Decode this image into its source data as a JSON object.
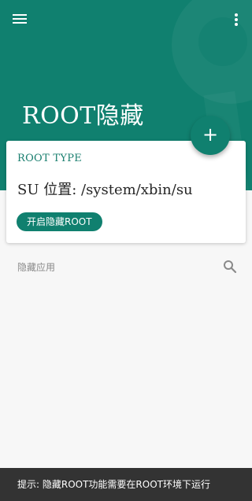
{
  "app": {
    "title": "ROOT隐藏",
    "menu_icon": "hamburger-menu-icon",
    "more_icon": "more-vertical-icon",
    "accent_color": "#10806f"
  },
  "card": {
    "label": "ROOT TYPE",
    "su_path": "SU 位置: /system/xbin/su",
    "action_button": "开启隐藏ROOT"
  },
  "fab": {
    "icon": "plus-icon",
    "symbol": "+"
  },
  "hidden_apps": {
    "header": "隐藏应用",
    "search_icon": "search-icon"
  },
  "toast": {
    "message": "提示: 隐藏ROOT功能需要在ROOT环境下运行"
  }
}
